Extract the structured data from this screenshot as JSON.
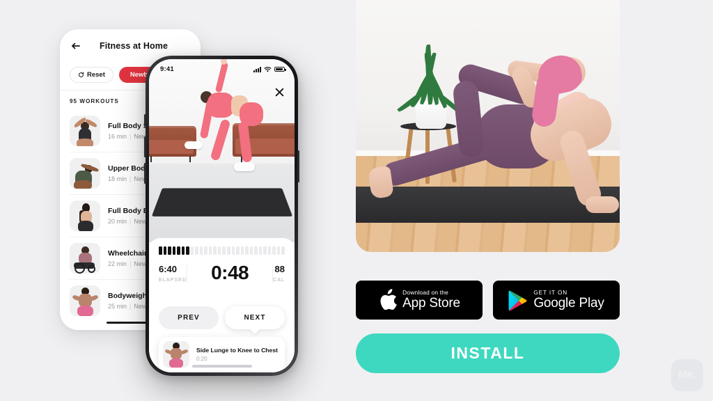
{
  "background_color": "#f0f0f2",
  "accent_colors": {
    "newbie_pill": "#e0343f",
    "install_button": "#3ed8c0",
    "badge_background": "#000000"
  },
  "list_card": {
    "back_icon": "arrow-left-icon",
    "title": "Fitness at Home",
    "filters": [
      {
        "label": "Reset",
        "icon": "reset-icon",
        "style": "outline"
      },
      {
        "label": "Newbie",
        "style": "active"
      }
    ],
    "count_label": "95 WORKOUTS",
    "workouts": [
      {
        "name": "Full Body Set",
        "duration": "16 min",
        "level": "Newbie"
      },
      {
        "name": "Upper Body Ea",
        "duration": "18 min",
        "level": "Newbie"
      },
      {
        "name": "Full Body Burn",
        "duration": "20 min",
        "level": "Newbie"
      },
      {
        "name": "Wheelchair Ca",
        "duration": "22 min",
        "level": "Newbie"
      },
      {
        "name": "Bodyweight W",
        "duration": "25 min",
        "level": "Newbie"
      }
    ],
    "separator": "|"
  },
  "phone": {
    "status_bar": {
      "time": "9:41",
      "icons": [
        "signal-icon",
        "wifi-icon",
        "battery-icon"
      ]
    },
    "close_icon": "close-icon",
    "video": {
      "description": "Woman in pink activewear exercising on a black yoga mat"
    },
    "progress": {
      "total_segments": 28,
      "filled_segments": 7
    },
    "timer": {
      "elapsed_value": "6:40",
      "elapsed_label": "ELAPSED",
      "current_value": "0:48",
      "calories_value": "88",
      "calories_label": "CAL"
    },
    "controls": {
      "prev_label": "PREV",
      "next_label": "NEXT"
    },
    "up_next": {
      "title": "Side Lunge to Knee to Chest",
      "time": "0:20"
    }
  },
  "hero": {
    "description": "Woman with pink hair in purple leggings performing a side plank on a yoga mat next to a plant on a wooden stool"
  },
  "store_badges": [
    {
      "id": "app-store",
      "icon": "apple-logo-icon",
      "small": "Download on the",
      "big": "App Store"
    },
    {
      "id": "google-play",
      "icon": "google-play-icon",
      "small": "GET IT ON",
      "big": "Google Play"
    }
  ],
  "install_button": {
    "label": "INSTALL"
  },
  "watermark": {
    "label": "Me."
  }
}
